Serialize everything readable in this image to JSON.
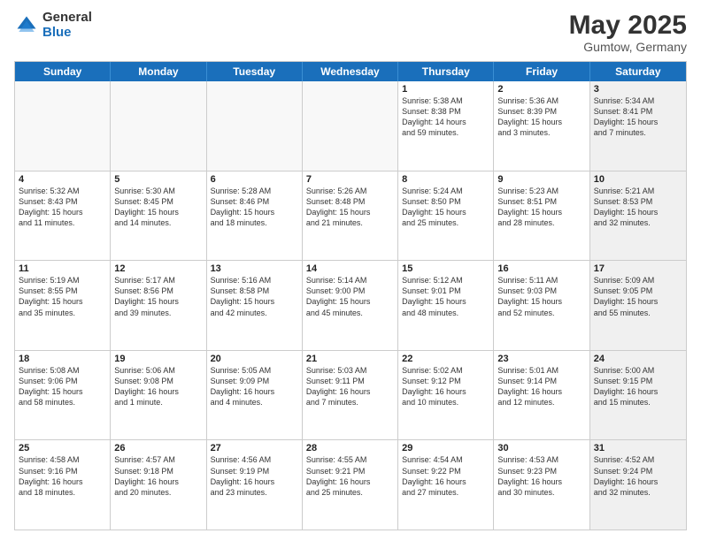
{
  "logo": {
    "general": "General",
    "blue": "Blue"
  },
  "header": {
    "month": "May 2025",
    "location": "Gumtow, Germany"
  },
  "days": [
    "Sunday",
    "Monday",
    "Tuesday",
    "Wednesday",
    "Thursday",
    "Friday",
    "Saturday"
  ],
  "weeks": [
    [
      {
        "day": "",
        "info": "",
        "empty": true
      },
      {
        "day": "",
        "info": "",
        "empty": true
      },
      {
        "day": "",
        "info": "",
        "empty": true
      },
      {
        "day": "",
        "info": "",
        "empty": true
      },
      {
        "day": "1",
        "info": "Sunrise: 5:38 AM\nSunset: 8:38 PM\nDaylight: 14 hours\nand 59 minutes."
      },
      {
        "day": "2",
        "info": "Sunrise: 5:36 AM\nSunset: 8:39 PM\nDaylight: 15 hours\nand 3 minutes."
      },
      {
        "day": "3",
        "info": "Sunrise: 5:34 AM\nSunset: 8:41 PM\nDaylight: 15 hours\nand 7 minutes.",
        "shaded": true
      }
    ],
    [
      {
        "day": "4",
        "info": "Sunrise: 5:32 AM\nSunset: 8:43 PM\nDaylight: 15 hours\nand 11 minutes."
      },
      {
        "day": "5",
        "info": "Sunrise: 5:30 AM\nSunset: 8:45 PM\nDaylight: 15 hours\nand 14 minutes."
      },
      {
        "day": "6",
        "info": "Sunrise: 5:28 AM\nSunset: 8:46 PM\nDaylight: 15 hours\nand 18 minutes."
      },
      {
        "day": "7",
        "info": "Sunrise: 5:26 AM\nSunset: 8:48 PM\nDaylight: 15 hours\nand 21 minutes."
      },
      {
        "day": "8",
        "info": "Sunrise: 5:24 AM\nSunset: 8:50 PM\nDaylight: 15 hours\nand 25 minutes."
      },
      {
        "day": "9",
        "info": "Sunrise: 5:23 AM\nSunset: 8:51 PM\nDaylight: 15 hours\nand 28 minutes."
      },
      {
        "day": "10",
        "info": "Sunrise: 5:21 AM\nSunset: 8:53 PM\nDaylight: 15 hours\nand 32 minutes.",
        "shaded": true
      }
    ],
    [
      {
        "day": "11",
        "info": "Sunrise: 5:19 AM\nSunset: 8:55 PM\nDaylight: 15 hours\nand 35 minutes."
      },
      {
        "day": "12",
        "info": "Sunrise: 5:17 AM\nSunset: 8:56 PM\nDaylight: 15 hours\nand 39 minutes."
      },
      {
        "day": "13",
        "info": "Sunrise: 5:16 AM\nSunset: 8:58 PM\nDaylight: 15 hours\nand 42 minutes."
      },
      {
        "day": "14",
        "info": "Sunrise: 5:14 AM\nSunset: 9:00 PM\nDaylight: 15 hours\nand 45 minutes."
      },
      {
        "day": "15",
        "info": "Sunrise: 5:12 AM\nSunset: 9:01 PM\nDaylight: 15 hours\nand 48 minutes."
      },
      {
        "day": "16",
        "info": "Sunrise: 5:11 AM\nSunset: 9:03 PM\nDaylight: 15 hours\nand 52 minutes."
      },
      {
        "day": "17",
        "info": "Sunrise: 5:09 AM\nSunset: 9:05 PM\nDaylight: 15 hours\nand 55 minutes.",
        "shaded": true
      }
    ],
    [
      {
        "day": "18",
        "info": "Sunrise: 5:08 AM\nSunset: 9:06 PM\nDaylight: 15 hours\nand 58 minutes."
      },
      {
        "day": "19",
        "info": "Sunrise: 5:06 AM\nSunset: 9:08 PM\nDaylight: 16 hours\nand 1 minute."
      },
      {
        "day": "20",
        "info": "Sunrise: 5:05 AM\nSunset: 9:09 PM\nDaylight: 16 hours\nand 4 minutes."
      },
      {
        "day": "21",
        "info": "Sunrise: 5:03 AM\nSunset: 9:11 PM\nDaylight: 16 hours\nand 7 minutes."
      },
      {
        "day": "22",
        "info": "Sunrise: 5:02 AM\nSunset: 9:12 PM\nDaylight: 16 hours\nand 10 minutes."
      },
      {
        "day": "23",
        "info": "Sunrise: 5:01 AM\nSunset: 9:14 PM\nDaylight: 16 hours\nand 12 minutes."
      },
      {
        "day": "24",
        "info": "Sunrise: 5:00 AM\nSunset: 9:15 PM\nDaylight: 16 hours\nand 15 minutes.",
        "shaded": true
      }
    ],
    [
      {
        "day": "25",
        "info": "Sunrise: 4:58 AM\nSunset: 9:16 PM\nDaylight: 16 hours\nand 18 minutes."
      },
      {
        "day": "26",
        "info": "Sunrise: 4:57 AM\nSunset: 9:18 PM\nDaylight: 16 hours\nand 20 minutes."
      },
      {
        "day": "27",
        "info": "Sunrise: 4:56 AM\nSunset: 9:19 PM\nDaylight: 16 hours\nand 23 minutes."
      },
      {
        "day": "28",
        "info": "Sunrise: 4:55 AM\nSunset: 9:21 PM\nDaylight: 16 hours\nand 25 minutes."
      },
      {
        "day": "29",
        "info": "Sunrise: 4:54 AM\nSunset: 9:22 PM\nDaylight: 16 hours\nand 27 minutes."
      },
      {
        "day": "30",
        "info": "Sunrise: 4:53 AM\nSunset: 9:23 PM\nDaylight: 16 hours\nand 30 minutes."
      },
      {
        "day": "31",
        "info": "Sunrise: 4:52 AM\nSunset: 9:24 PM\nDaylight: 16 hours\nand 32 minutes.",
        "shaded": true
      }
    ]
  ]
}
